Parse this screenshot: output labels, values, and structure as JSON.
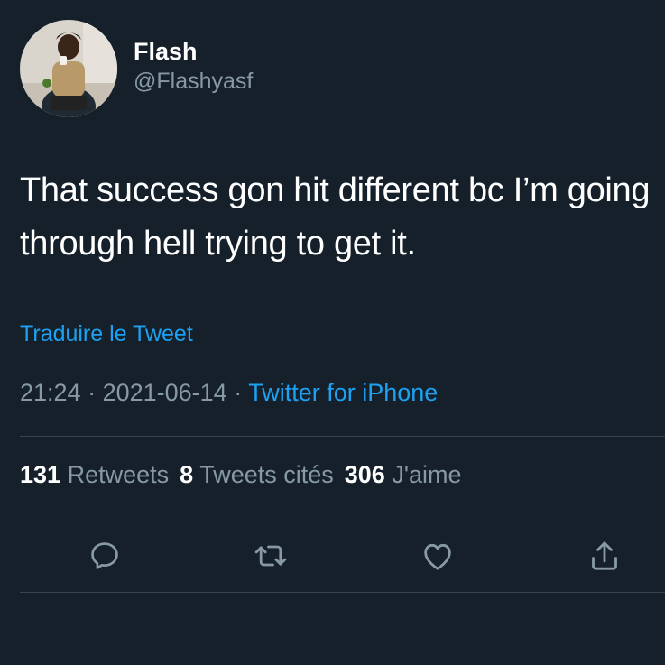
{
  "user": {
    "display_name": "Flash",
    "handle": "@Flashyasf"
  },
  "tweet": {
    "text": "That success gon hit different bc I’m going through hell trying to get it.",
    "translate_label": "Traduire le Tweet"
  },
  "meta": {
    "time": "21:24",
    "separator": " · ",
    "date": "2021-06-14",
    "source": "Twitter for iPhone"
  },
  "stats": {
    "retweets_count": "131",
    "retweets_label": "Retweets",
    "quotes_count": "8",
    "quotes_label": "Tweets cités",
    "likes_count": "306",
    "likes_label": "J'aime"
  },
  "icons": {
    "reply": "reply-icon",
    "retweet": "retweet-icon",
    "like": "heart-icon",
    "share": "share-icon"
  },
  "colors": {
    "background": "#15202b",
    "primary_text": "#ffffff",
    "secondary_text": "#8899a6",
    "accent": "#1da1f2",
    "divider": "#38444d"
  }
}
